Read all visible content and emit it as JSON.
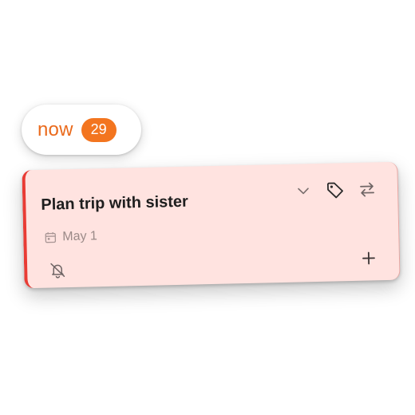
{
  "filter_pill": {
    "label": "now",
    "count": "29"
  },
  "task_card": {
    "title": "Plan trip with sister",
    "due_date": "May 1",
    "accent_color": "#e93b34",
    "background_color": "#ffe3e0",
    "icons": [
      "chevron-down-icon",
      "tag-icon",
      "swap-arrows-icon",
      "calendar-icon",
      "bell-off-icon",
      "plus-icon"
    ]
  },
  "colors": {
    "pill_text": "#ea6a1c",
    "pill_badge": "#f3751f"
  }
}
